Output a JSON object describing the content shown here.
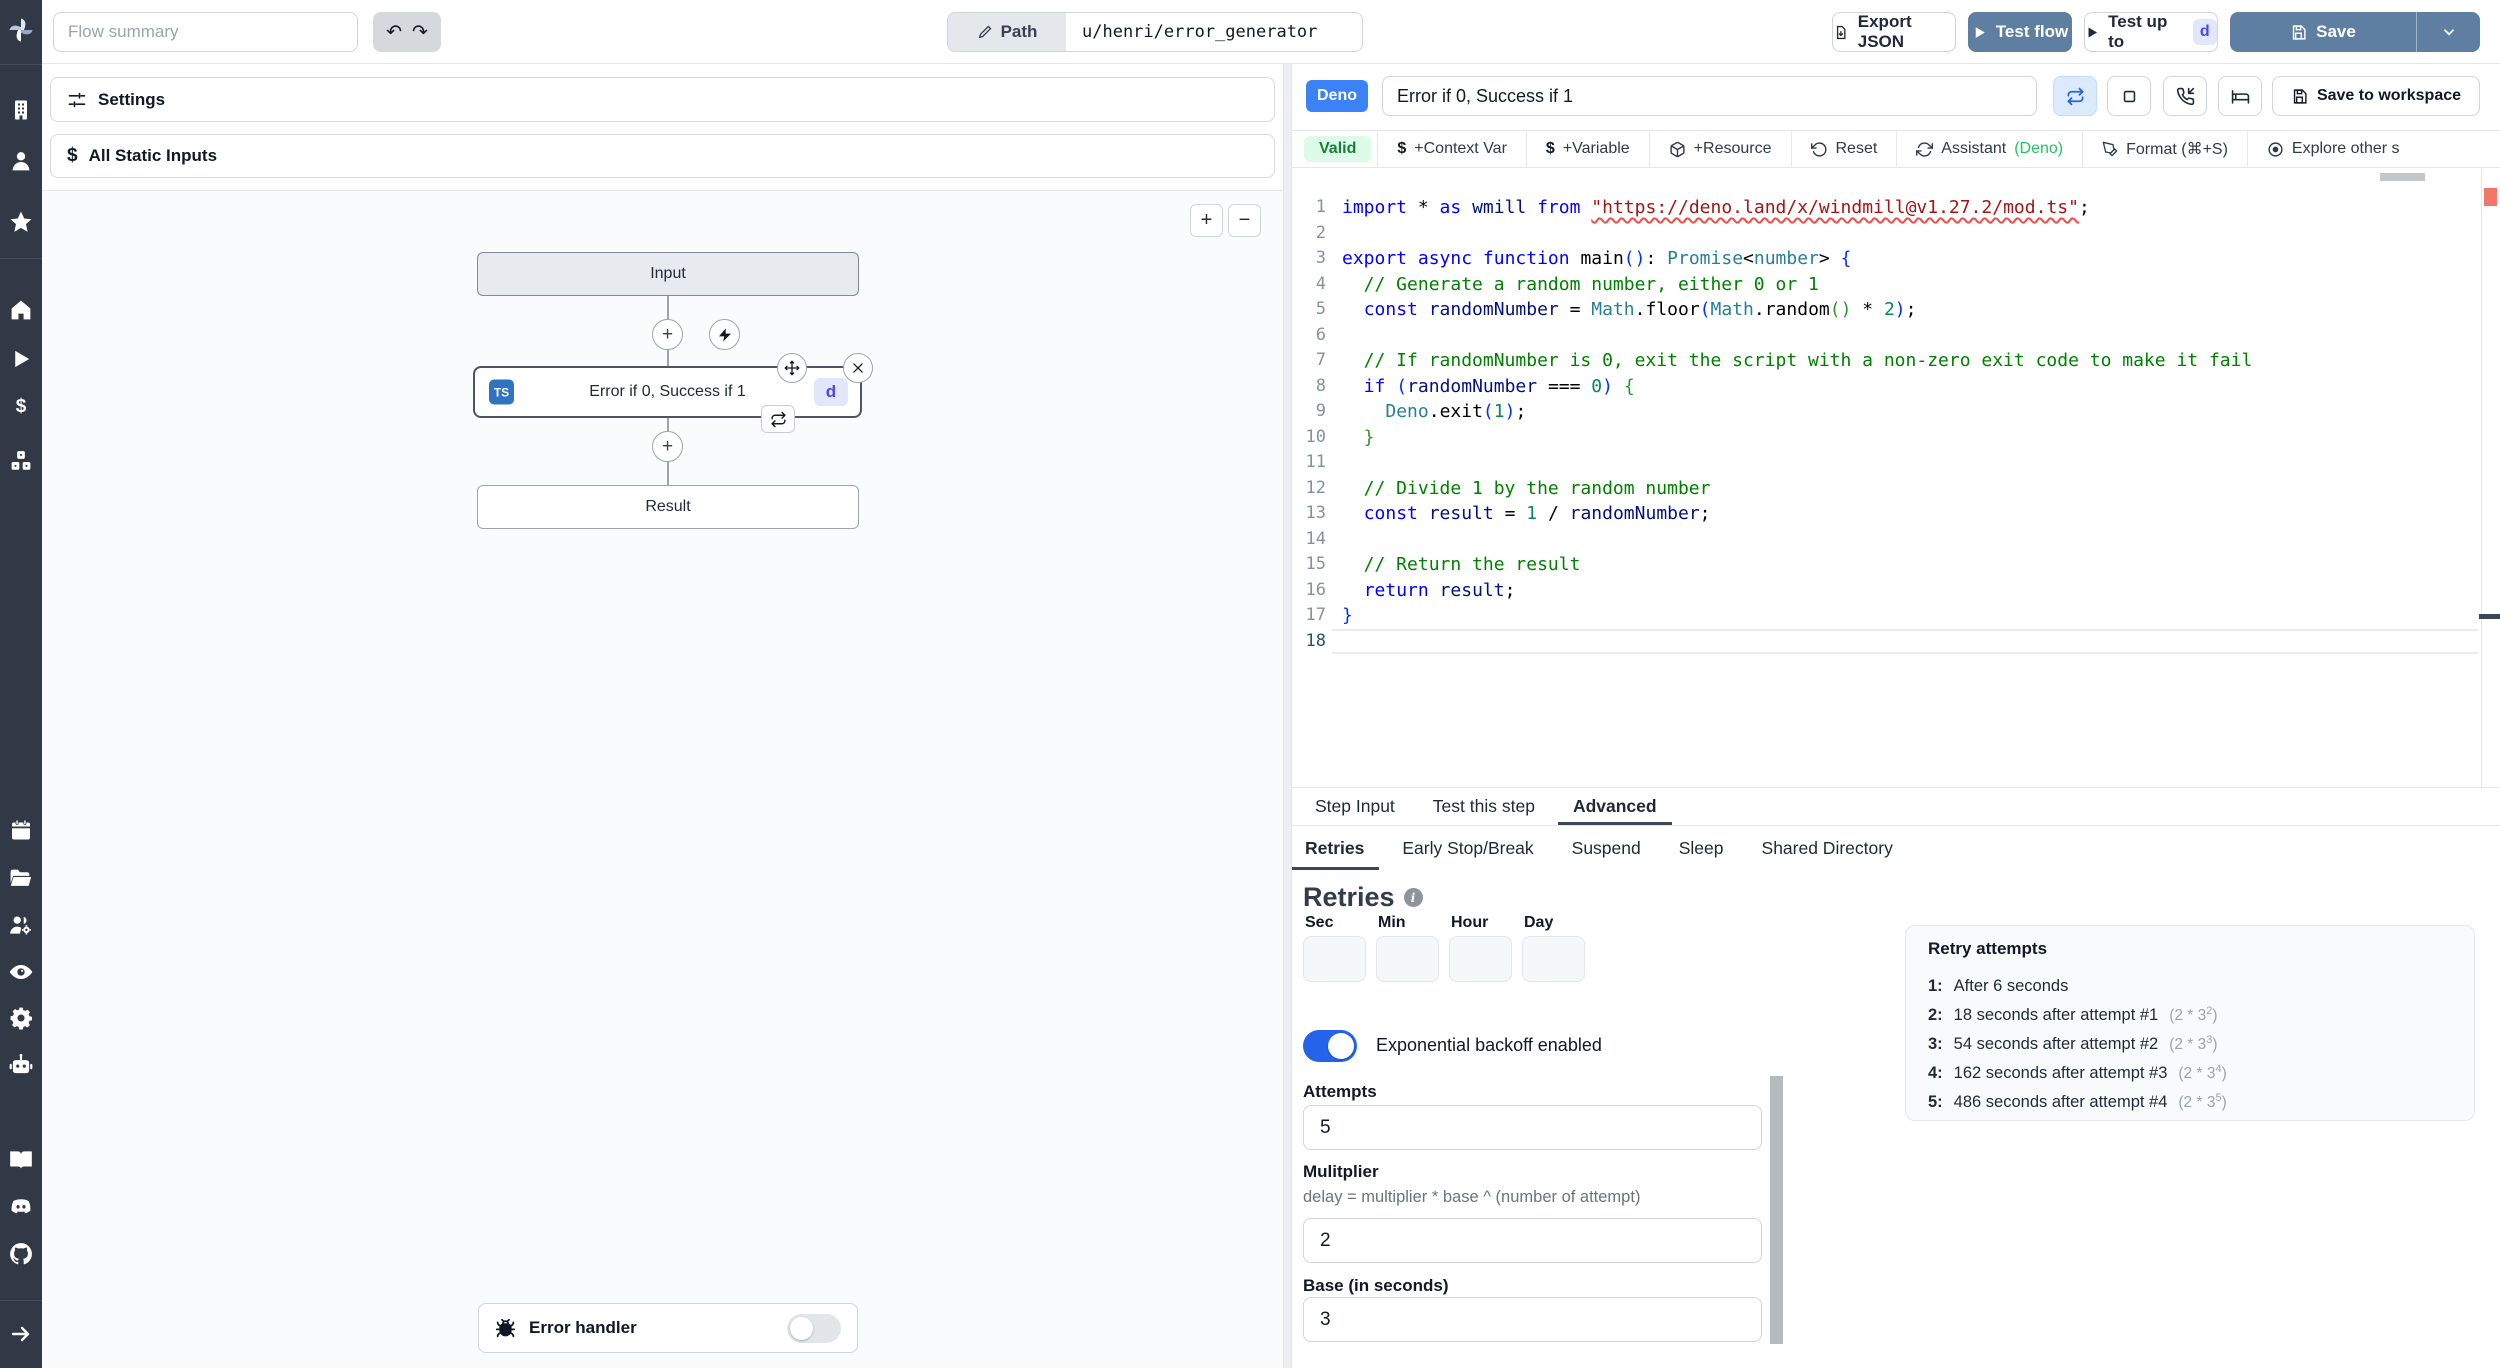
{
  "colors": {
    "sidebar_bg": "#313947",
    "primary_button": "#5f7fa2",
    "deno_badge": "#3b82f6",
    "valid_bg": "#dcfce7",
    "valid_text": "#15803d",
    "toggle_on": "#2563eb",
    "d_badge_bg": "#e0e7ff",
    "d_badge_text": "#4f46e5",
    "error_marker": "#f3766b",
    "assistant_lang_green": "#22c55e",
    "ts_badge": "#2f74c0"
  },
  "sidebar": {
    "icons": [
      "windmill-logo",
      "workspace-building",
      "user",
      "star-favorites",
      "home",
      "play-runs",
      "dollar-variables",
      "cubes-resources",
      "calendar-schedules",
      "folder",
      "users-groups",
      "eye-audit",
      "gear-settings",
      "robot-workers",
      "book-docs",
      "discord",
      "github",
      "arrow-expand"
    ]
  },
  "topbar": {
    "flow_summary_placeholder": "Flow summary",
    "path_label": "Path",
    "path_value": "u/henri/error_generator",
    "export_json": "Export JSON",
    "test_flow": "Test flow",
    "test_up_to": "Test up to",
    "test_up_to_badge": "d",
    "save": "Save"
  },
  "flow_panel": {
    "settings": "Settings",
    "static_inputs": "All Static Inputs",
    "dollar": "$",
    "zoom_in": "+",
    "zoom_out": "−",
    "input_node": "Input",
    "step_lang": "TS",
    "step_badge": "d",
    "result_node": "Result",
    "error_handler": "Error handler"
  },
  "step_name": "Error if 0, Success if 1",
  "editor_header": {
    "deno_badge": "Deno",
    "save_to_workspace": "Save to workspace"
  },
  "toolbar": {
    "valid": "Valid",
    "dollar": "$",
    "context_var": "+Context Var",
    "variable": "+Variable",
    "resource": "+Resource",
    "reset": "Reset",
    "assistant": "Assistant",
    "assistant_lang": "(Deno)",
    "format": "Format (⌘+S)",
    "explore": "Explore other s"
  },
  "editor": {
    "active_line": 18,
    "lines": [
      [
        [
          "kw",
          "import"
        ],
        [
          "pun",
          " * "
        ],
        [
          "kw",
          "as"
        ],
        [
          "var",
          " wmill "
        ],
        [
          "kw",
          "from"
        ],
        [
          "pun",
          " "
        ],
        [
          "strerr",
          "\"https://deno.land/x/windmill@v1.27.2/mod.ts\""
        ],
        [
          "pun",
          ";"
        ]
      ],
      [],
      [
        [
          "kw",
          "export"
        ],
        [
          "pun",
          " "
        ],
        [
          "kw",
          "async"
        ],
        [
          "pun",
          " "
        ],
        [
          "kw",
          "function"
        ],
        [
          "fn",
          " main"
        ],
        [
          "br1",
          "()"
        ],
        [
          "pun",
          ": "
        ],
        [
          "type",
          "Promise"
        ],
        [
          "pun",
          "<"
        ],
        [
          "type",
          "number"
        ],
        [
          "pun",
          "> "
        ],
        [
          "br1",
          "{"
        ]
      ],
      [
        [
          "com",
          "  // Generate a random number, either 0 or 1"
        ]
      ],
      [
        [
          "pun",
          "  "
        ],
        [
          "kw",
          "const"
        ],
        [
          "var",
          " randomNumber "
        ],
        [
          "op",
          "= "
        ],
        [
          "type",
          "Math"
        ],
        [
          "pun",
          "."
        ],
        [
          "fn",
          "floor"
        ],
        [
          "br1",
          "("
        ],
        [
          "type",
          "Math"
        ],
        [
          "pun",
          "."
        ],
        [
          "fn",
          "random"
        ],
        [
          "br2",
          "()"
        ],
        [
          "op",
          " * "
        ],
        [
          "num",
          "2"
        ],
        [
          "br1",
          ")"
        ],
        [
          "pun",
          ";"
        ]
      ],
      [],
      [
        [
          "com",
          "  // If randomNumber is 0, exit the script with a non-zero exit code to make it fail"
        ]
      ],
      [
        [
          "pun",
          "  "
        ],
        [
          "kw",
          "if"
        ],
        [
          "pun",
          " "
        ],
        [
          "br1",
          "("
        ],
        [
          "var",
          "randomNumber"
        ],
        [
          "op",
          " === "
        ],
        [
          "num",
          "0"
        ],
        [
          "br1",
          ")"
        ],
        [
          "pun",
          " "
        ],
        [
          "br2",
          "{"
        ]
      ],
      [
        [
          "pun",
          "    "
        ],
        [
          "type",
          "Deno"
        ],
        [
          "pun",
          "."
        ],
        [
          "fn",
          "exit"
        ],
        [
          "br1",
          "("
        ],
        [
          "num",
          "1"
        ],
        [
          "br1",
          ")"
        ],
        [
          "pun",
          ";"
        ]
      ],
      [
        [
          "br2",
          "  }"
        ]
      ],
      [],
      [
        [
          "com",
          "  // Divide 1 by the random number"
        ]
      ],
      [
        [
          "pun",
          "  "
        ],
        [
          "kw",
          "const"
        ],
        [
          "var",
          " result "
        ],
        [
          "op",
          "= "
        ],
        [
          "num",
          "1"
        ],
        [
          "op",
          " / "
        ],
        [
          "var",
          "randomNumber"
        ],
        [
          "pun",
          ";"
        ]
      ],
      [],
      [
        [
          "com",
          "  // Return the result"
        ]
      ],
      [
        [
          "pun",
          "  "
        ],
        [
          "kw",
          "return"
        ],
        [
          "var",
          " result"
        ],
        [
          "pun",
          ";"
        ]
      ],
      [
        [
          "br1",
          "}"
        ]
      ],
      []
    ]
  },
  "step_tabs": [
    {
      "label": "Step Input",
      "active": false
    },
    {
      "label": "Test this step",
      "active": false
    },
    {
      "label": "Advanced",
      "active": true
    }
  ],
  "advanced_tabs": [
    {
      "label": "Retries",
      "active": true
    },
    {
      "label": "Early Stop/Break",
      "active": false
    },
    {
      "label": "Suspend",
      "active": false
    },
    {
      "label": "Sleep",
      "active": false
    },
    {
      "label": "Shared Directory",
      "active": false
    }
  ],
  "retries": {
    "title": "Retries",
    "info": "i",
    "time_fields": [
      "Sec",
      "Min",
      "Hour",
      "Day"
    ],
    "backoff_label": "Exponential backoff enabled",
    "attempts_label": "Attempts",
    "attempts_value": "5",
    "multiplier_label": "Mulitplier",
    "multiplier_hint": "delay = multiplier * base ^ (number of attempt)",
    "multiplier_value": "2",
    "base_label": "Base (in seconds)",
    "base_value": "3"
  },
  "retry_attempts": {
    "title": "Retry attempts",
    "rows": [
      {
        "index": "1:",
        "text": "After 6 seconds",
        "formula_base": "",
        "formula_exp": ""
      },
      {
        "index": "2:",
        "text": "18 seconds after attempt #1",
        "formula_base": "(2 * 3",
        "formula_exp": "2"
      },
      {
        "index": "3:",
        "text": "54 seconds after attempt #2",
        "formula_base": "(2 * 3",
        "formula_exp": "3"
      },
      {
        "index": "4:",
        "text": "162 seconds after attempt #3",
        "formula_base": "(2 * 3",
        "formula_exp": "4"
      },
      {
        "index": "5:",
        "text": "486 seconds after attempt #4",
        "formula_base": "(2 * 3",
        "formula_exp": "5"
      }
    ]
  }
}
